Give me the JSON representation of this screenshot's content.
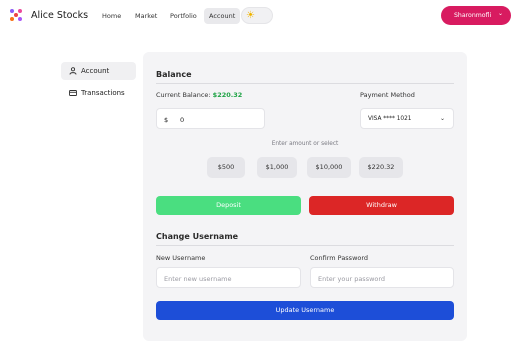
{
  "app": {
    "brand": "Alice Stocks",
    "nav": [
      "Home",
      "Market",
      "Portfolio",
      "Account"
    ],
    "active_nav": "Account",
    "theme_icon": "sun-icon",
    "user": {
      "name": "Sharonmofli",
      "menu_icon": "chevron-down-icon"
    }
  },
  "sidebar": {
    "items": [
      {
        "label": "Account",
        "icon": "user-icon",
        "active": true
      },
      {
        "label": "Transactions",
        "icon": "card-icon",
        "active": false
      }
    ]
  },
  "balance": {
    "title": "Balance",
    "current_label": "Current Balance:",
    "current_value": "$220.32",
    "amount_prefix": "$",
    "amount_value": "0",
    "payment_label": "Payment Method",
    "payment_value": "VISA **** 1021",
    "hint": "Enter amount or select",
    "presets": [
      "$500",
      "$1,000",
      "$10,000",
      "$220.32"
    ],
    "deposit_label": "Deposit",
    "withdraw_label": "Withdraw"
  },
  "change_username": {
    "title": "Change Username",
    "new_label": "New Username",
    "new_placeholder": "Enter new username",
    "confirm_label": "Confirm Password",
    "confirm_placeholder": "Enter your password",
    "submit_label": "Update Username"
  },
  "colors": {
    "accent_pink": "#d81b60",
    "positive_green": "#1fa346",
    "deposit": "#4ade80",
    "withdraw": "#dc2626",
    "primary": "#1d4ed8"
  }
}
